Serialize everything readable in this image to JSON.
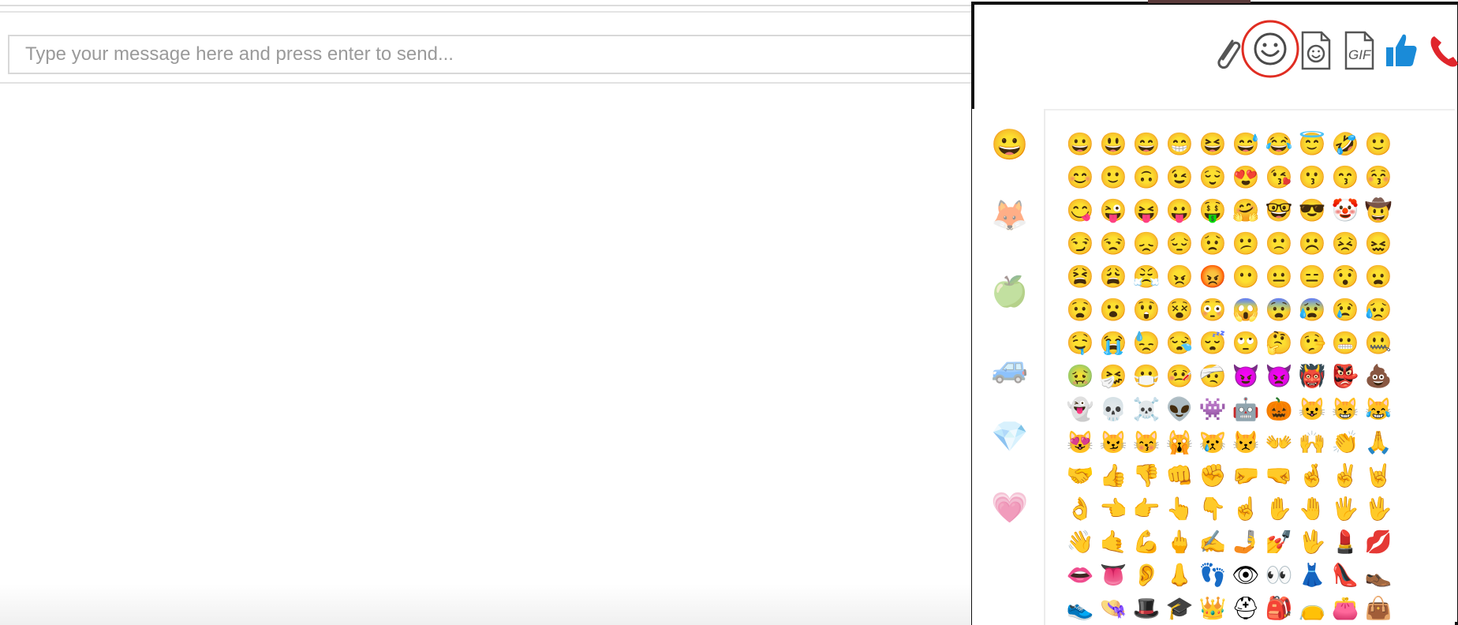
{
  "message": {
    "placeholder": "Type your message here and press enter to send...",
    "value": ""
  },
  "toolbar": [
    {
      "name": "attach-icon",
      "label": "Attach file"
    },
    {
      "name": "emoji-icon",
      "label": "Emoji",
      "highlighted": true,
      "highlight_color": "#e02d22"
    },
    {
      "name": "sticker-icon",
      "label": "Sticker"
    },
    {
      "name": "gif-icon",
      "label": "GIF"
    },
    {
      "name": "thumbs-up-icon",
      "label": "Like",
      "color": "#1a8bd8"
    },
    {
      "name": "phone-icon",
      "label": "Call",
      "color": "#e0252b"
    }
  ],
  "picker": {
    "categories": [
      {
        "name": "smileys",
        "glyph": "😀"
      },
      {
        "name": "animals",
        "glyph": "🦊"
      },
      {
        "name": "food",
        "glyph": "🍏"
      },
      {
        "name": "travel",
        "glyph": "🚙"
      },
      {
        "name": "objects",
        "glyph": "💎"
      },
      {
        "name": "symbols",
        "glyph": "💗"
      }
    ],
    "emojis": [
      "😀",
      "😃",
      "😄",
      "😁",
      "😆",
      "😅",
      "😂",
      "😇",
      "🤣",
      "🙂",
      "😊",
      "🙂",
      "🙃",
      "😉",
      "😌",
      "😍",
      "😘",
      "😗",
      "😙",
      "😚",
      "😋",
      "😜",
      "😝",
      "😛",
      "🤑",
      "🤗",
      "🤓",
      "😎",
      "🤡",
      "🤠",
      "😏",
      "😒",
      "😞",
      "😔",
      "😟",
      "😕",
      "🙁",
      "☹️",
      "😣",
      "😖",
      "😫",
      "😩",
      "😤",
      "😠",
      "😡",
      "😶",
      "😐",
      "😑",
      "😯",
      "😦",
      "😧",
      "😮",
      "😲",
      "😵",
      "😳",
      "😱",
      "😨",
      "😰",
      "😢",
      "😥",
      "🤤",
      "😭",
      "😓",
      "😪",
      "😴",
      "🙄",
      "🤔",
      "🤥",
      "😬",
      "🤐",
      "🤢",
      "🤧",
      "😷",
      "🤒",
      "🤕",
      "😈",
      "👿",
      "👹",
      "👺",
      "💩",
      "👻",
      "💀",
      "☠️",
      "👽",
      "👾",
      "🤖",
      "🎃",
      "😺",
      "😸",
      "😹",
      "😻",
      "😼",
      "😽",
      "🙀",
      "😿",
      "😾",
      "👐",
      "🙌",
      "👏",
      "🙏",
      "🤝",
      "👍",
      "👎",
      "👊",
      "✊",
      "🤛",
      "🤜",
      "🤞",
      "✌️",
      "🤘",
      "👌",
      "👈",
      "👉",
      "👆",
      "👇",
      "☝️",
      "✋",
      "🤚",
      "🖐",
      "🖖",
      "👋",
      "🤙",
      "💪",
      "🖕",
      "✍️",
      "🤳",
      "💅",
      "🖖",
      "💄",
      "💋",
      "👄",
      "👅",
      "👂",
      "👃",
      "👣",
      "👁",
      "👀",
      "👗",
      "👠",
      "👞",
      "👟",
      "👒",
      "🎩",
      "🎓",
      "👑",
      "⛑",
      "🎒",
      "👝",
      "👛",
      "👜"
    ]
  }
}
